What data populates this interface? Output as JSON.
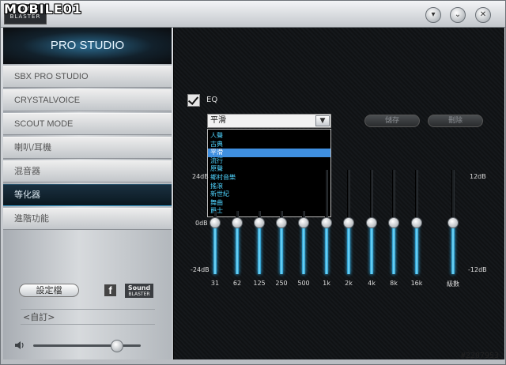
{
  "watermark": "MOBILE01",
  "titlebar": {
    "logo_line1": "SOUND",
    "logo_line2": "BLASTER",
    "buttons": [
      "settings-icon",
      "minimize-icon",
      "close-icon"
    ]
  },
  "sidebar": {
    "brand": "PRO STUDIO",
    "items": [
      {
        "label": "SBX PRO STUDIO"
      },
      {
        "label": "CRYSTALVOICE"
      },
      {
        "label": "SCOUT MODE"
      },
      {
        "label": "喇叭/耳機"
      },
      {
        "label": "混音器"
      },
      {
        "label": "等化器"
      },
      {
        "label": "進階功能"
      }
    ],
    "active_index": 5,
    "profile_button": "設定檔",
    "facebook_glyph": "f",
    "sb_logo_line1": "Sound",
    "sb_logo_line2": "BLASTER",
    "custom_label": "<自訂>",
    "volume_level": 0.77
  },
  "eq": {
    "checkbox_label": "EQ",
    "checked": true,
    "preset_value": "平滑",
    "preset_options": [
      "人聲",
      "古典",
      "平滑",
      "流行",
      "原聲",
      "鄉村音樂",
      "搖滾",
      "新世紀",
      "舞曲",
      "爵士"
    ],
    "selected_option_index": 2,
    "save_button": "儲存",
    "delete_button": "刪除",
    "db_top": "24dB",
    "db_mid": "0dB",
    "db_bottom": "-24dB",
    "db_top_right": "12dB",
    "db_bottom_right": "-12dB",
    "bands": [
      {
        "label": "31",
        "value": 0
      },
      {
        "label": "62",
        "value": 0
      },
      {
        "label": "125",
        "value": 0
      },
      {
        "label": "250",
        "value": 0
      },
      {
        "label": "500",
        "value": 0
      },
      {
        "label": "1k",
        "value": 0
      },
      {
        "label": "2k",
        "value": 0
      },
      {
        "label": "4k",
        "value": 0
      },
      {
        "label": "8k",
        "value": 0
      },
      {
        "label": "16k",
        "value": 0
      }
    ],
    "master": {
      "label": "級數",
      "value": 0
    }
  },
  "credit": "#2207953"
}
